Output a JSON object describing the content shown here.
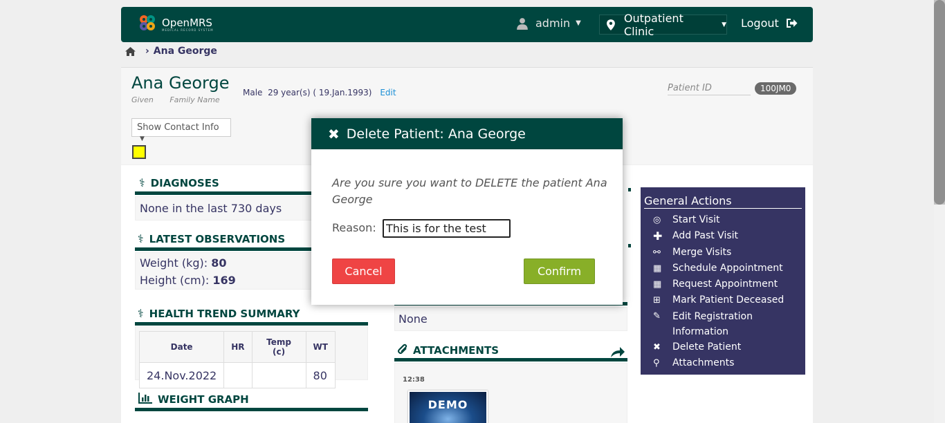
{
  "header": {
    "logo_text": "OpenMRS",
    "logo_sub": "MEDICAL RECORD SYSTEM",
    "user": "admin",
    "location": "Outpatient Clinic",
    "logout": "Logout"
  },
  "breadcrumb": {
    "current": "Ana George"
  },
  "patient": {
    "name": "Ana George",
    "given_label": "Given",
    "family_label": "Family Name",
    "gender": "Male",
    "age": "29 year(s) ( 19.Jan.1993)",
    "edit": "Edit",
    "id_label": "Patient ID",
    "id_value": "100JM0",
    "contact_btn": "Show Contact Info"
  },
  "diagnoses": {
    "title": "DIAGNOSES",
    "text": "None in the last 730 days"
  },
  "observations": {
    "title": "LATEST OBSERVATIONS",
    "weight_label": "Weight (kg):",
    "weight_value": "80",
    "height_label": "Height (cm):",
    "height_value": "169"
  },
  "health_trend": {
    "title": "HEALTH TREND SUMMARY",
    "headers": [
      "Date",
      "HR",
      "Temp (c)",
      "WT"
    ],
    "rows": [
      [
        "24.Nov.2022",
        "",
        "",
        "80"
      ]
    ]
  },
  "weight_graph": {
    "title": "WEIGHT GRAPH"
  },
  "middle": {
    "none_text": "None"
  },
  "attachments": {
    "title": "ATTACHMENTS",
    "time": "12:38",
    "thumb_text": "DEMO"
  },
  "general_actions": {
    "title": "General Actions",
    "items": [
      {
        "label": "Start Visit",
        "icon": "map-marker-icon"
      },
      {
        "label": "Add Past Visit",
        "icon": "plus-icon"
      },
      {
        "label": "Merge Visits",
        "icon": "link-icon"
      },
      {
        "label": "Schedule Appointment",
        "icon": "calendar-icon"
      },
      {
        "label": "Request Appointment",
        "icon": "calendar-icon"
      },
      {
        "label": "Mark Patient Deceased",
        "icon": "plus-box-icon"
      },
      {
        "label": "Edit Registration Information",
        "icon": "pencil-icon"
      },
      {
        "label": "Delete Patient",
        "icon": "close-icon"
      },
      {
        "label": "Attachments",
        "icon": "paperclip-icon"
      }
    ]
  },
  "modal": {
    "title": "Delete Patient: Ana George",
    "message": "Are you sure you want to DELETE the patient Ana George",
    "reason_label": "Reason:",
    "reason_value": "This is for the test",
    "cancel": "Cancel",
    "confirm": "Confirm"
  }
}
